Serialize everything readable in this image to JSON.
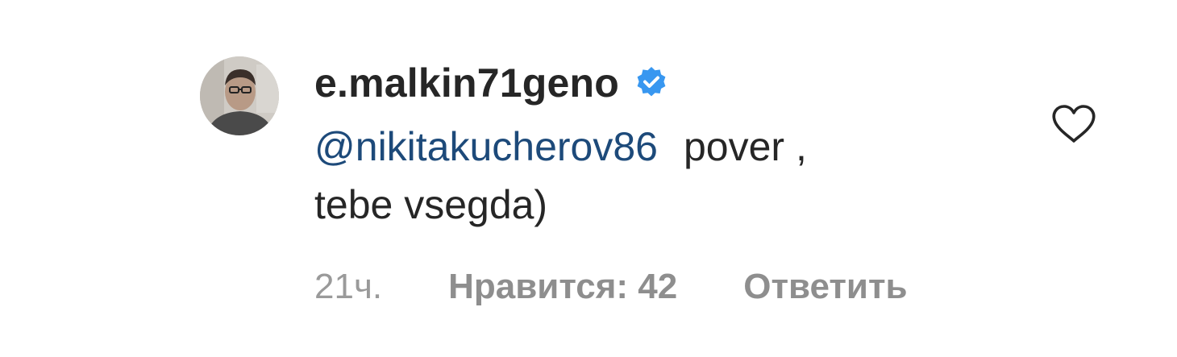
{
  "comment": {
    "username": "e.malkin71geno",
    "verified": true,
    "mention": "@nikitakucherov86",
    "text_line1": "pover ,",
    "text_line2": "tebe vsegda)",
    "time": "21ч.",
    "likes_label": "Нравится: 42",
    "reply_label": "Ответить"
  },
  "icons": {
    "verified": "verified-badge-icon",
    "like": "heart-outline-icon"
  },
  "colors": {
    "text": "#262626",
    "mention": "#1d4a7a",
    "meta": "#8e8e8e",
    "verified": "#3897f0"
  }
}
